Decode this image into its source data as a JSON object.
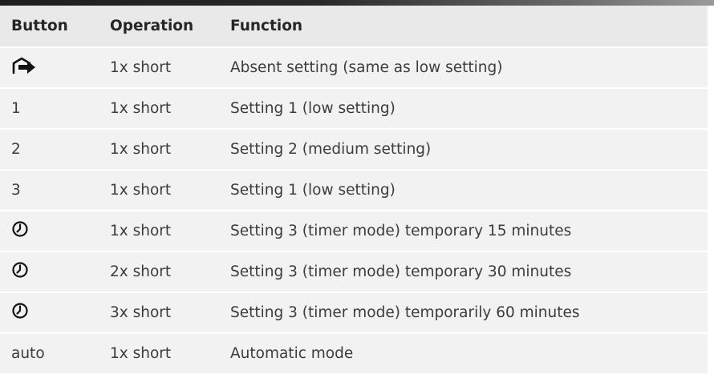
{
  "headers": {
    "button": "Button",
    "operation": "Operation",
    "function": "Function"
  },
  "rows": [
    {
      "button_icon": "house-arrow-icon",
      "button": "",
      "operation": "1x short",
      "function": "Absent setting (same as low setting)"
    },
    {
      "button_icon": "",
      "button": "1",
      "operation": "1x short",
      "function": "Setting 1 (low setting)"
    },
    {
      "button_icon": "",
      "button": "2",
      "operation": "1x short",
      "function": "Setting 2 (medium setting)"
    },
    {
      "button_icon": "",
      "button": "3",
      "operation": "1x short",
      "function": "Setting 1 (low setting)"
    },
    {
      "button_icon": "clock-icon",
      "button": "",
      "operation": "1x short",
      "function": "Setting 3 (timer mode) temporary 15 minutes"
    },
    {
      "button_icon": "clock-icon",
      "button": "",
      "operation": "2x short",
      "function": "Setting 3 (timer mode) temporary 30 minutes"
    },
    {
      "button_icon": "clock-icon",
      "button": "",
      "operation": "3x short",
      "function": "Setting 3 (timer mode) temporarily 60 minutes"
    },
    {
      "button_icon": "",
      "button": "auto",
      "operation": "1x short",
      "function": "Automatic mode"
    }
  ]
}
